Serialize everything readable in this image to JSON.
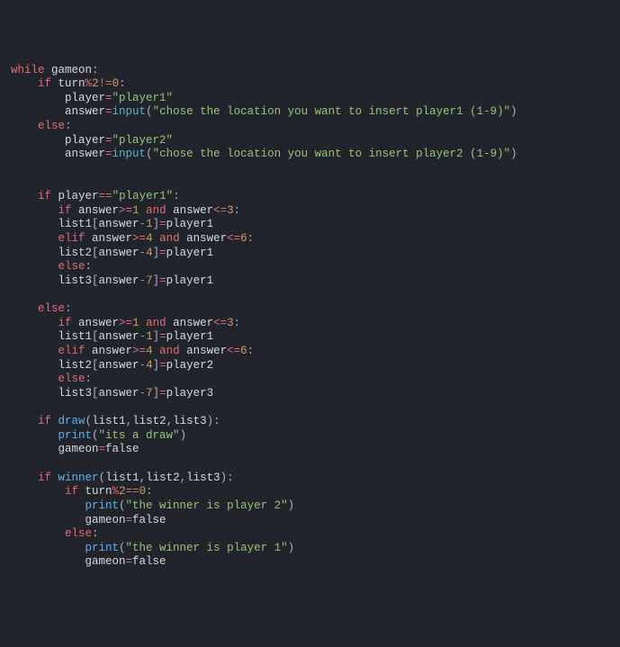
{
  "code_tokens": [
    [
      {
        "t": "while",
        "c": "kw-control"
      },
      {
        "t": " gameon",
        "c": "identifier"
      },
      {
        "t": ":",
        "c": "op-punct"
      }
    ],
    [
      {
        "t": "    ",
        "c": ""
      },
      {
        "t": "if",
        "c": "kw-control"
      },
      {
        "t": " turn",
        "c": "identifier"
      },
      {
        "t": "%",
        "c": "kw-operator"
      },
      {
        "t": "2",
        "c": "number"
      },
      {
        "t": "!=",
        "c": "kw-operator"
      },
      {
        "t": "0",
        "c": "number"
      },
      {
        "t": ":",
        "c": "op-punct"
      }
    ],
    [
      {
        "t": "        player",
        "c": "identifier"
      },
      {
        "t": "=",
        "c": "assign"
      },
      {
        "t": "\"player1\"",
        "c": "string"
      }
    ],
    [
      {
        "t": "        answer",
        "c": "identifier"
      },
      {
        "t": "=",
        "c": "assign"
      },
      {
        "t": "input",
        "c": "builtin"
      },
      {
        "t": "(",
        "c": "op-punct"
      },
      {
        "t": "\"chose the location you want to insert player1 (1-9)\"",
        "c": "string"
      },
      {
        "t": ")",
        "c": "op-punct"
      }
    ],
    [
      {
        "t": "    ",
        "c": ""
      },
      {
        "t": "else",
        "c": "kw-control"
      },
      {
        "t": ":",
        "c": "op-punct"
      }
    ],
    [
      {
        "t": "        player",
        "c": "identifier"
      },
      {
        "t": "=",
        "c": "assign"
      },
      {
        "t": "\"player2\"",
        "c": "string"
      }
    ],
    [
      {
        "t": "        answer",
        "c": "identifier"
      },
      {
        "t": "=",
        "c": "assign"
      },
      {
        "t": "input",
        "c": "builtin"
      },
      {
        "t": "(",
        "c": "op-punct"
      },
      {
        "t": "\"chose the location you want to insert player2 (1-9)\"",
        "c": "string"
      },
      {
        "t": ")",
        "c": "op-punct"
      }
    ],
    [],
    [],
    [
      {
        "t": "    ",
        "c": ""
      },
      {
        "t": "if",
        "c": "kw-control"
      },
      {
        "t": " player",
        "c": "identifier"
      },
      {
        "t": "==",
        "c": "kw-operator"
      },
      {
        "t": "\"player1\"",
        "c": "string"
      },
      {
        "t": ":",
        "c": "op-punct"
      }
    ],
    [
      {
        "t": "       ",
        "c": ""
      },
      {
        "t": "if",
        "c": "kw-control"
      },
      {
        "t": " answer",
        "c": "identifier"
      },
      {
        "t": ">=",
        "c": "kw-operator"
      },
      {
        "t": "1",
        "c": "number"
      },
      {
        "t": " ",
        "c": ""
      },
      {
        "t": "and",
        "c": "kw-operator"
      },
      {
        "t": " answer",
        "c": "identifier"
      },
      {
        "t": "<=",
        "c": "kw-operator"
      },
      {
        "t": "3",
        "c": "number"
      },
      {
        "t": ":",
        "c": "op-punct"
      }
    ],
    [
      {
        "t": "       list1",
        "c": "identifier"
      },
      {
        "t": "[",
        "c": "op-punct"
      },
      {
        "t": "answer",
        "c": "identifier"
      },
      {
        "t": "-",
        "c": "kw-operator"
      },
      {
        "t": "1",
        "c": "number"
      },
      {
        "t": "]",
        "c": "op-punct"
      },
      {
        "t": "=",
        "c": "assign"
      },
      {
        "t": "player1",
        "c": "identifier"
      }
    ],
    [
      {
        "t": "       ",
        "c": ""
      },
      {
        "t": "elif",
        "c": "kw-control"
      },
      {
        "t": " answer",
        "c": "identifier"
      },
      {
        "t": ">=",
        "c": "kw-operator"
      },
      {
        "t": "4",
        "c": "number"
      },
      {
        "t": " ",
        "c": ""
      },
      {
        "t": "and",
        "c": "kw-operator"
      },
      {
        "t": " answer",
        "c": "identifier"
      },
      {
        "t": "<=",
        "c": "kw-operator"
      },
      {
        "t": "6",
        "c": "number"
      },
      {
        "t": ":",
        "c": "op-punct"
      }
    ],
    [
      {
        "t": "       list2",
        "c": "identifier"
      },
      {
        "t": "[",
        "c": "op-punct"
      },
      {
        "t": "answer",
        "c": "identifier"
      },
      {
        "t": "-",
        "c": "kw-operator"
      },
      {
        "t": "4",
        "c": "number"
      },
      {
        "t": "]",
        "c": "op-punct"
      },
      {
        "t": "=",
        "c": "assign"
      },
      {
        "t": "player1",
        "c": "identifier"
      }
    ],
    [
      {
        "t": "       ",
        "c": ""
      },
      {
        "t": "else",
        "c": "kw-control"
      },
      {
        "t": ":",
        "c": "op-punct"
      }
    ],
    [
      {
        "t": "       list3",
        "c": "identifier"
      },
      {
        "t": "[",
        "c": "op-punct"
      },
      {
        "t": "answer",
        "c": "identifier"
      },
      {
        "t": "-",
        "c": "kw-operator"
      },
      {
        "t": "7",
        "c": "number"
      },
      {
        "t": "]",
        "c": "op-punct"
      },
      {
        "t": "=",
        "c": "assign"
      },
      {
        "t": "player1",
        "c": "identifier"
      }
    ],
    [],
    [
      {
        "t": "    ",
        "c": ""
      },
      {
        "t": "else",
        "c": "kw-control"
      },
      {
        "t": ":",
        "c": "op-punct"
      }
    ],
    [
      {
        "t": "       ",
        "c": ""
      },
      {
        "t": "if",
        "c": "kw-control"
      },
      {
        "t": " answer",
        "c": "identifier"
      },
      {
        "t": ">=",
        "c": "kw-operator"
      },
      {
        "t": "1",
        "c": "number"
      },
      {
        "t": " ",
        "c": ""
      },
      {
        "t": "and",
        "c": "kw-operator"
      },
      {
        "t": " answer",
        "c": "identifier"
      },
      {
        "t": "<=",
        "c": "kw-operator"
      },
      {
        "t": "3",
        "c": "number"
      },
      {
        "t": ":",
        "c": "op-punct"
      }
    ],
    [
      {
        "t": "       list1",
        "c": "identifier"
      },
      {
        "t": "[",
        "c": "op-punct"
      },
      {
        "t": "answer",
        "c": "identifier"
      },
      {
        "t": "-",
        "c": "kw-operator"
      },
      {
        "t": "1",
        "c": "number"
      },
      {
        "t": "]",
        "c": "op-punct"
      },
      {
        "t": "=",
        "c": "assign"
      },
      {
        "t": "player1",
        "c": "identifier"
      }
    ],
    [
      {
        "t": "       ",
        "c": ""
      },
      {
        "t": "elif",
        "c": "kw-control"
      },
      {
        "t": " answer",
        "c": "identifier"
      },
      {
        "t": ">=",
        "c": "kw-operator"
      },
      {
        "t": "4",
        "c": "number"
      },
      {
        "t": " ",
        "c": ""
      },
      {
        "t": "and",
        "c": "kw-operator"
      },
      {
        "t": " answer",
        "c": "identifier"
      },
      {
        "t": "<=",
        "c": "kw-operator"
      },
      {
        "t": "6",
        "c": "number"
      },
      {
        "t": ":",
        "c": "op-punct"
      }
    ],
    [
      {
        "t": "       list2",
        "c": "identifier"
      },
      {
        "t": "[",
        "c": "op-punct"
      },
      {
        "t": "answer",
        "c": "identifier"
      },
      {
        "t": "-",
        "c": "kw-operator"
      },
      {
        "t": "4",
        "c": "number"
      },
      {
        "t": "]",
        "c": "op-punct"
      },
      {
        "t": "=",
        "c": "assign"
      },
      {
        "t": "player2",
        "c": "identifier"
      }
    ],
    [
      {
        "t": "       ",
        "c": ""
      },
      {
        "t": "else",
        "c": "kw-control"
      },
      {
        "t": ":",
        "c": "op-punct"
      }
    ],
    [
      {
        "t": "       list3",
        "c": "identifier"
      },
      {
        "t": "[",
        "c": "op-punct"
      },
      {
        "t": "answer",
        "c": "identifier"
      },
      {
        "t": "-",
        "c": "kw-operator"
      },
      {
        "t": "7",
        "c": "number"
      },
      {
        "t": "]",
        "c": "op-punct"
      },
      {
        "t": "=",
        "c": "assign"
      },
      {
        "t": "player3",
        "c": "identifier"
      }
    ],
    [],
    [
      {
        "t": "    ",
        "c": ""
      },
      {
        "t": "if",
        "c": "kw-control"
      },
      {
        "t": " ",
        "c": ""
      },
      {
        "t": "draw",
        "c": "func"
      },
      {
        "t": "(",
        "c": "op-punct"
      },
      {
        "t": "list1",
        "c": "identifier"
      },
      {
        "t": ",",
        "c": "op-punct"
      },
      {
        "t": "list2",
        "c": "identifier"
      },
      {
        "t": ",",
        "c": "op-punct"
      },
      {
        "t": "list3",
        "c": "identifier"
      },
      {
        "t": ")",
        "c": "op-punct"
      },
      {
        "t": ":",
        "c": "op-punct"
      }
    ],
    [
      {
        "t": "       ",
        "c": ""
      },
      {
        "t": "print",
        "c": "func"
      },
      {
        "t": "(",
        "c": "op-punct"
      },
      {
        "t": "\"its a draw\"",
        "c": "string"
      },
      {
        "t": ")",
        "c": "op-punct"
      }
    ],
    [
      {
        "t": "       gameon",
        "c": "identifier"
      },
      {
        "t": "=",
        "c": "assign"
      },
      {
        "t": "false",
        "c": "identifier"
      }
    ],
    [],
    [
      {
        "t": "    ",
        "c": ""
      },
      {
        "t": "if",
        "c": "kw-control"
      },
      {
        "t": " ",
        "c": ""
      },
      {
        "t": "winner",
        "c": "func"
      },
      {
        "t": "(",
        "c": "op-punct"
      },
      {
        "t": "list1",
        "c": "identifier"
      },
      {
        "t": ",",
        "c": "op-punct"
      },
      {
        "t": "list2",
        "c": "identifier"
      },
      {
        "t": ",",
        "c": "op-punct"
      },
      {
        "t": "list3",
        "c": "identifier"
      },
      {
        "t": ")",
        "c": "op-punct"
      },
      {
        "t": ":",
        "c": "op-punct"
      }
    ],
    [
      {
        "t": "        ",
        "c": ""
      },
      {
        "t": "if",
        "c": "kw-control"
      },
      {
        "t": " turn",
        "c": "identifier"
      },
      {
        "t": "%",
        "c": "kw-operator"
      },
      {
        "t": "2",
        "c": "number"
      },
      {
        "t": "==",
        "c": "kw-operator"
      },
      {
        "t": "0",
        "c": "number"
      },
      {
        "t": ":",
        "c": "op-punct"
      }
    ],
    [
      {
        "t": "           ",
        "c": ""
      },
      {
        "t": "print",
        "c": "func"
      },
      {
        "t": "(",
        "c": "op-punct"
      },
      {
        "t": "\"the winner is player 2\"",
        "c": "string"
      },
      {
        "t": ")",
        "c": "op-punct"
      }
    ],
    [
      {
        "t": "           gameon",
        "c": "identifier"
      },
      {
        "t": "=",
        "c": "assign"
      },
      {
        "t": "false",
        "c": "identifier"
      }
    ],
    [
      {
        "t": "        ",
        "c": ""
      },
      {
        "t": "else",
        "c": "kw-control"
      },
      {
        "t": ":",
        "c": "op-punct"
      }
    ],
    [
      {
        "t": "           ",
        "c": ""
      },
      {
        "t": "print",
        "c": "func"
      },
      {
        "t": "(",
        "c": "op-punct"
      },
      {
        "t": "\"the winner is player 1\"",
        "c": "string"
      },
      {
        "t": ")",
        "c": "op-punct"
      }
    ],
    [
      {
        "t": "           gameon",
        "c": "identifier"
      },
      {
        "t": "=",
        "c": "assign"
      },
      {
        "t": "false",
        "c": "identifier"
      }
    ]
  ]
}
